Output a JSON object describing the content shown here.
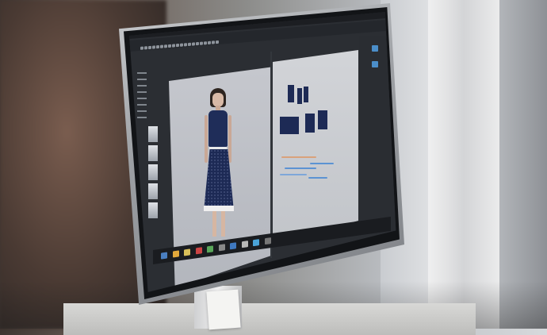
{
  "scene": {
    "description_tags": [
      "monitor",
      "fashion-cad-software",
      "3d-avatar",
      "pattern-pieces"
    ]
  },
  "app": {
    "menu_items": [
      "File",
      "Edit",
      "3D Garment",
      "2D Pattern",
      "Sewing",
      "Materials",
      "Avatar",
      "Render",
      "Display",
      "Preferences",
      "Settings",
      "Help"
    ]
  },
  "colors": {
    "garment": "#1d2a55",
    "viewport_bg": "#c6c8ce",
    "ui_dark": "#2b2e33",
    "accent": "#4b8ec9"
  },
  "icons": {
    "taskbar": [
      "start-icon",
      "ie-icon",
      "folder-icon",
      "media-icon",
      "app-icon",
      "app-icon",
      "app-icon",
      "app-icon",
      "app-icon",
      "app-icon"
    ]
  }
}
